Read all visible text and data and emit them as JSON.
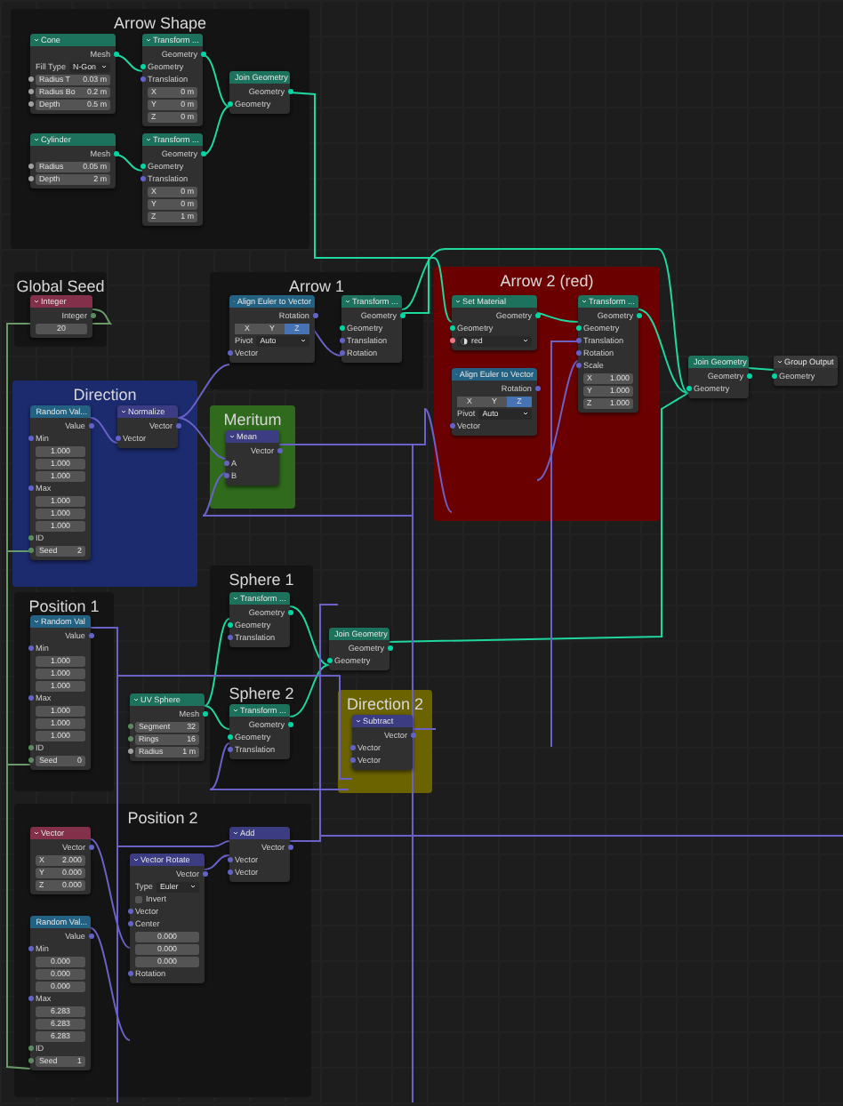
{
  "frames": [
    {
      "title": "Arrow Shape",
      "color": "#141414",
      "nodes": [
        {
          "title": "Cone",
          "kind": "geometry",
          "rows": [
            {
              "kind": "output",
              "label": "Mesh",
              "color": "#00d6a3"
            },
            {
              "kind": "dropdown",
              "label": "Fill Type",
              "value": "N-Gon"
            },
            {
              "kind": "field",
              "label": "Radius T",
              "value": "0.03 m",
              "color": "#a1a1a1"
            },
            {
              "kind": "field",
              "label": "Radius Bo",
              "value": "0.2 m",
              "color": "#a1a1a1"
            },
            {
              "kind": "field",
              "label": "Depth",
              "value": "0.5 m",
              "color": "#a1a1a1"
            }
          ]
        },
        {
          "title": "Cylinder",
          "kind": "geometry",
          "rows": [
            {
              "kind": "output",
              "label": "Mesh",
              "color": "#00d6a3"
            },
            {
              "kind": "field",
              "label": "Radius",
              "value": "0.05 m",
              "color": "#a1a1a1"
            },
            {
              "kind": "field",
              "label": "Depth",
              "value": "2 m",
              "color": "#a1a1a1"
            }
          ]
        },
        {
          "title": "Transform ...",
          "kind": "geometry",
          "rows": [
            {
              "kind": "output",
              "label": "Geometry",
              "color": "#00d6a3"
            },
            {
              "kind": "input",
              "label": "Geometry",
              "color": "#00d6a3"
            },
            {
              "kind": "input",
              "label": "Translation",
              "color": "#6363c7"
            },
            {
              "kind": "field",
              "label": "X",
              "value": "0 m"
            },
            {
              "kind": "field",
              "label": "Y",
              "value": "0 m"
            },
            {
              "kind": "field",
              "label": "Z",
              "value": "0 m"
            }
          ]
        },
        {
          "title": "Transform ...",
          "kind": "geometry",
          "rows": [
            {
              "kind": "output",
              "label": "Geometry",
              "color": "#00d6a3"
            },
            {
              "kind": "input",
              "label": "Geometry",
              "color": "#00d6a3"
            },
            {
              "kind": "input",
              "label": "Translation",
              "color": "#6363c7"
            },
            {
              "kind": "field",
              "label": "X",
              "value": "0 m"
            },
            {
              "kind": "field",
              "label": "Y",
              "value": "0 m"
            },
            {
              "kind": "field",
              "label": "Z",
              "value": "1 m"
            }
          ]
        },
        {
          "title": "Join Geometry",
          "kind": "geometry",
          "rows": [
            {
              "kind": "output",
              "label": "Geometry",
              "color": "#00d6a3"
            },
            {
              "kind": "input",
              "label": "Geometry",
              "color": "#00d6a3"
            }
          ]
        }
      ]
    },
    {
      "title": "Global Seed",
      "color": "#141414",
      "nodes": [
        {
          "title": "Integer",
          "kind": "input",
          "rows": [
            {
              "kind": "output",
              "label": "Integer",
              "color": "#598c5c"
            },
            {
              "kind": "field",
              "value": "20"
            }
          ]
        }
      ]
    },
    {
      "title": "Arrow 1",
      "color": "#141414",
      "nodes": [
        {
          "title": "Align Euler to Vector",
          "kind": "converter",
          "rows": [
            {
              "kind": "output",
              "label": "Rotation",
              "color": "#6363c7"
            },
            {
              "kind": "axis",
              "buttons": [
                {
                  "label": "X",
                  "selected": false
                },
                {
                  "label": "Y",
                  "selected": false
                },
                {
                  "label": "Z",
                  "selected": true
                }
              ]
            },
            {
              "kind": "dropdown",
              "label": "Pivot",
              "value": "Auto"
            },
            {
              "kind": "input",
              "label": "Vector",
              "color": "#6363c7"
            }
          ]
        },
        {
          "title": "Transform ...",
          "kind": "geometry",
          "rows": [
            {
              "kind": "output",
              "label": "Geometry",
              "color": "#00d6a3"
            },
            {
              "kind": "input",
              "label": "Geometry",
              "color": "#00d6a3"
            },
            {
              "kind": "input",
              "label": "Translation",
              "color": "#6363c7"
            },
            {
              "kind": "input",
              "label": "Rotation",
              "color": "#6363c7"
            }
          ]
        }
      ]
    },
    {
      "title": "Arrow 2 (red)",
      "color": "#6b0000",
      "nodes": [
        {
          "title": "Set Material",
          "kind": "geometry",
          "rows": [
            {
              "kind": "output",
              "label": "Geometry",
              "color": "#00d6a3"
            },
            {
              "kind": "input",
              "label": "Geometry",
              "color": "#00d6a3"
            },
            {
              "kind": "material",
              "value": "red",
              "color": "#eb7582"
            }
          ]
        },
        {
          "title": "Align Euler to Vector",
          "kind": "converter",
          "rows": [
            {
              "kind": "output",
              "label": "Rotation",
              "color": "#6363c7"
            },
            {
              "kind": "axis",
              "buttons": [
                {
                  "label": "X",
                  "selected": false
                },
                {
                  "label": "Y",
                  "selected": false
                },
                {
                  "label": "Z",
                  "selected": true
                }
              ]
            },
            {
              "kind": "dropdown",
              "label": "Pivot",
              "value": "Auto"
            },
            {
              "kind": "input",
              "label": "Vector",
              "color": "#6363c7"
            }
          ]
        },
        {
          "title": "Transform ...",
          "kind": "geometry",
          "rows": [
            {
              "kind": "output",
              "label": "Geometry",
              "color": "#00d6a3"
            },
            {
              "kind": "input",
              "label": "Geometry",
              "color": "#00d6a3"
            },
            {
              "kind": "input",
              "label": "Translation",
              "color": "#6363c7"
            },
            {
              "kind": "input",
              "label": "Rotation",
              "color": "#6363c7"
            },
            {
              "kind": "input",
              "label": "Scale",
              "color": "#6363c7"
            },
            {
              "kind": "field",
              "label": "X",
              "value": "1.000"
            },
            {
              "kind": "field",
              "label": "Y",
              "value": "1.000"
            },
            {
              "kind": "field",
              "label": "Z",
              "value": "1.000"
            }
          ]
        }
      ]
    },
    {
      "title": "Direction",
      "color": "#1c2a6e",
      "nodes": [
        {
          "title": "Random Val...",
          "kind": "converter",
          "rows": [
            {
              "kind": "output",
              "label": "Value",
              "color": "#6363c7"
            },
            {
              "kind": "input",
              "label": "Min",
              "color": "#6363c7"
            },
            {
              "kind": "field",
              "value": "1.000"
            },
            {
              "kind": "field",
              "value": "1.000"
            },
            {
              "kind": "field",
              "value": "1.000"
            },
            {
              "kind": "input",
              "label": "Max",
              "color": "#6363c7"
            },
            {
              "kind": "field",
              "value": "1.000"
            },
            {
              "kind": "field",
              "value": "1.000"
            },
            {
              "kind": "field",
              "value": "1.000"
            },
            {
              "kind": "input",
              "label": "ID",
              "color": "#598c5c"
            },
            {
              "kind": "field",
              "label": "Seed",
              "value": "2",
              "color": "#598c5c"
            }
          ]
        },
        {
          "title": "Normalize",
          "kind": "vector",
          "rows": [
            {
              "kind": "output",
              "label": "Vector",
              "color": "#6363c7"
            },
            {
              "kind": "input",
              "label": "Vector",
              "color": "#6363c7"
            }
          ]
        }
      ]
    },
    {
      "title": "Meritum",
      "color": "#2f6a1d",
      "nodes": [
        {
          "title": "Mean",
          "kind": "vector",
          "rows": [
            {
              "kind": "output",
              "label": "Vector",
              "color": "#6363c7"
            },
            {
              "kind": "input",
              "label": "A",
              "color": "#6363c7"
            },
            {
              "kind": "input",
              "label": "B",
              "color": "#6363c7"
            }
          ]
        }
      ]
    },
    {
      "title": "Position 1",
      "color": "#141414",
      "nodes": [
        {
          "title": "Random Val",
          "kind": "converter",
          "rows": [
            {
              "kind": "output",
              "label": "Value",
              "color": "#6363c7"
            },
            {
              "kind": "input",
              "label": "Min",
              "color": "#6363c7"
            },
            {
              "kind": "field",
              "value": "1.000"
            },
            {
              "kind": "field",
              "value": "1.000"
            },
            {
              "kind": "field",
              "value": "1.000"
            },
            {
              "kind": "input",
              "label": "Max",
              "color": "#6363c7"
            },
            {
              "kind": "field",
              "value": "1.000"
            },
            {
              "kind": "field",
              "value": "1.000"
            },
            {
              "kind": "field",
              "value": "1.000"
            },
            {
              "kind": "input",
              "label": "ID",
              "color": "#598c5c"
            },
            {
              "kind": "field",
              "label": "Seed",
              "value": "0",
              "color": "#598c5c"
            }
          ]
        }
      ]
    },
    {
      "title": "Sphere 1",
      "color": "#141414",
      "nodes": [
        {
          "title": "Transform ...",
          "kind": "geometry",
          "rows": [
            {
              "kind": "output",
              "label": "Geometry",
              "color": "#00d6a3"
            },
            {
              "kind": "input",
              "label": "Geometry",
              "color": "#00d6a3"
            },
            {
              "kind": "input",
              "label": "Translation",
              "color": "#6363c7"
            }
          ]
        }
      ]
    },
    {
      "title": "Sphere 2",
      "color": "#141414",
      "nodes": [
        {
          "title": "Transform ...",
          "kind": "geometry",
          "rows": [
            {
              "kind": "output",
              "label": "Geometry",
              "color": "#00d6a3"
            },
            {
              "kind": "input",
              "label": "Geometry",
              "color": "#00d6a3"
            },
            {
              "kind": "input",
              "label": "Translation",
              "color": "#6363c7"
            }
          ]
        }
      ]
    },
    {
      "title": "Direction 2",
      "color": "#6b6200",
      "nodes": [
        {
          "title": "Subtract",
          "kind": "vector",
          "rows": [
            {
              "kind": "output",
              "label": "Vector",
              "color": "#6363c7"
            },
            {
              "kind": "input",
              "label": "Vector",
              "color": "#6363c7"
            },
            {
              "kind": "input",
              "label": "Vector",
              "color": "#6363c7"
            }
          ]
        }
      ]
    },
    {
      "title": "Position 2",
      "color": "#141414",
      "nodes": [
        {
          "title": "Vector",
          "kind": "input",
          "rows": [
            {
              "kind": "output",
              "label": "Vector",
              "color": "#6363c7"
            },
            {
              "kind": "field",
              "label": "X",
              "value": "2.000"
            },
            {
              "kind": "field",
              "label": "Y",
              "value": "0.000"
            },
            {
              "kind": "field",
              "label": "Z",
              "value": "0.000"
            }
          ]
        },
        {
          "title": "Random Val...",
          "kind": "converter",
          "rows": [
            {
              "kind": "output",
              "label": "Value",
              "color": "#6363c7"
            },
            {
              "kind": "input",
              "label": "Min",
              "color": "#6363c7"
            },
            {
              "kind": "field",
              "value": "0.000"
            },
            {
              "kind": "field",
              "value": "0.000"
            },
            {
              "kind": "field",
              "value": "0.000"
            },
            {
              "kind": "input",
              "label": "Max",
              "color": "#6363c7"
            },
            {
              "kind": "field",
              "value": "6.283"
            },
            {
              "kind": "field",
              "value": "6.283"
            },
            {
              "kind": "field",
              "value": "6.283"
            },
            {
              "kind": "input",
              "label": "ID",
              "color": "#598c5c"
            },
            {
              "kind": "field",
              "label": "Seed",
              "value": "1",
              "color": "#598c5c"
            }
          ]
        },
        {
          "title": "Vector Rotate",
          "kind": "vector",
          "rows": [
            {
              "kind": "output",
              "label": "Vector",
              "color": "#6363c7"
            },
            {
              "kind": "dropdown",
              "label": "Type",
              "value": "Euler"
            },
            {
              "kind": "checkbox",
              "label": "Invert",
              "checked": false
            },
            {
              "kind": "input",
              "label": "Vector",
              "color": "#6363c7"
            },
            {
              "kind": "input",
              "label": "Center",
              "color": "#6363c7"
            },
            {
              "kind": "field",
              "value": "0.000"
            },
            {
              "kind": "field",
              "value": "0.000"
            },
            {
              "kind": "field",
              "value": "0.000"
            },
            {
              "kind": "input",
              "label": "Rotation",
              "color": "#6363c7"
            }
          ]
        },
        {
          "title": "Add",
          "kind": "vector",
          "rows": [
            {
              "kind": "output",
              "label": "Vector",
              "color": "#6363c7"
            },
            {
              "kind": "input",
              "label": "Vector",
              "color": "#6363c7"
            },
            {
              "kind": "input",
              "label": "Vector",
              "color": "#6363c7"
            }
          ]
        }
      ]
    }
  ],
  "free_nodes": [
    {
      "title": "UV Sphere",
      "kind": "geometry",
      "rows": [
        {
          "kind": "output",
          "label": "Mesh",
          "color": "#00d6a3"
        },
        {
          "kind": "field",
          "label": "Segment",
          "value": "32",
          "color": "#598c5c"
        },
        {
          "kind": "field",
          "label": "Rings",
          "value": "16",
          "color": "#598c5c"
        },
        {
          "kind": "field",
          "label": "Radius",
          "value": "1 m",
          "color": "#a1a1a1"
        }
      ]
    },
    {
      "title": "Join Geometry",
      "kind": "geometry",
      "rows": [
        {
          "kind": "output",
          "label": "Geometry",
          "color": "#00d6a3"
        },
        {
          "kind": "input",
          "label": "Geometry",
          "color": "#00d6a3"
        }
      ]
    },
    {
      "title": "Join Geometry",
      "kind": "geometry",
      "rows": [
        {
          "kind": "output",
          "label": "Geometry",
          "color": "#00d6a3"
        },
        {
          "kind": "input",
          "label": "Geometry",
          "color": "#00d6a3"
        }
      ]
    },
    {
      "title": "Group Output",
      "kind": "output",
      "rows": [
        {
          "kind": "input",
          "label": "Geometry",
          "color": "#00d6a3"
        }
      ]
    }
  ]
}
